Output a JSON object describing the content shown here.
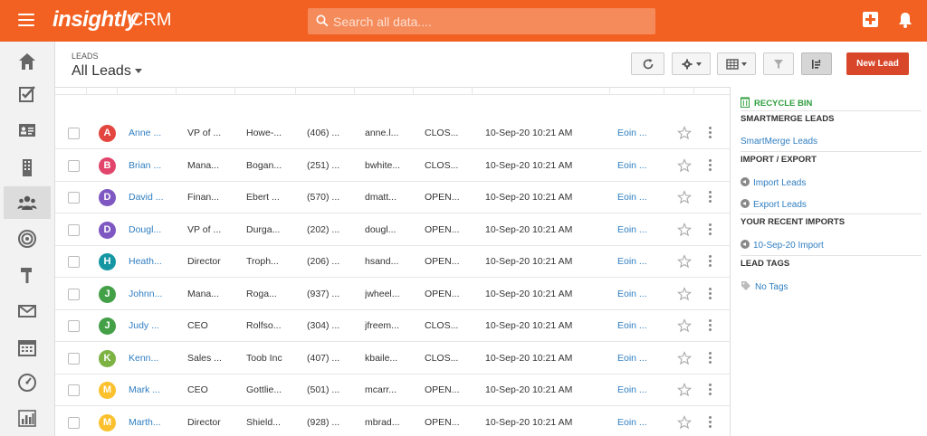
{
  "app": {
    "logo": "insightly",
    "name": "CRM",
    "brand_color": "#f26122"
  },
  "search": {
    "placeholder": "Search all data...."
  },
  "sidebar": {
    "items": [
      {
        "icon": "home-icon"
      },
      {
        "icon": "tasks-icon"
      },
      {
        "icon": "contacts-icon"
      },
      {
        "icon": "organizations-icon"
      },
      {
        "icon": "leads-icon",
        "active": true
      },
      {
        "icon": "opportunities-icon"
      },
      {
        "icon": "projects-icon"
      },
      {
        "icon": "email-icon"
      },
      {
        "icon": "calendar-icon"
      },
      {
        "icon": "dashboard-icon"
      },
      {
        "icon": "reports-icon"
      }
    ]
  },
  "header": {
    "breadcrumb": "LEADS",
    "view_title": "All Leads",
    "new_lead_label": "New Lead"
  },
  "leads": [
    {
      "initial": "A",
      "color": "#e2463e",
      "name": "Anne ...",
      "title": "VP of ...",
      "org": "Howe-...",
      "phone": "(406) ...",
      "email": "anne.l...",
      "status": "CLOS...",
      "date": "10-Sep-20 10:21 AM",
      "owner": "Eoin ..."
    },
    {
      "initial": "B",
      "color": "#e2456b",
      "name": "Brian ...",
      "title": "Mana...",
      "org": "Bogan...",
      "phone": "(251) ...",
      "email": "bwhite...",
      "status": "CLOS...",
      "date": "10-Sep-20 10:21 AM",
      "owner": "Eoin ..."
    },
    {
      "initial": "D",
      "color": "#7e57c2",
      "name": "David ...",
      "title": "Finan...",
      "org": "Ebert ...",
      "phone": "(570) ...",
      "email": "dmatt...",
      "status": "OPEN...",
      "date": "10-Sep-20 10:21 AM",
      "owner": "Eoin ..."
    },
    {
      "initial": "D",
      "color": "#7e57c2",
      "name": "Dougl...",
      "title": "VP of ...",
      "org": "Durga...",
      "phone": "(202) ...",
      "email": "dougl...",
      "status": "OPEN...",
      "date": "10-Sep-20 10:21 AM",
      "owner": "Eoin ..."
    },
    {
      "initial": "H",
      "color": "#1596a3",
      "name": "Heath...",
      "title": "Director",
      "org": "Troph...",
      "phone": "(206) ...",
      "email": "hsand...",
      "status": "OPEN...",
      "date": "10-Sep-20 10:21 AM",
      "owner": "Eoin ..."
    },
    {
      "initial": "J",
      "color": "#43a047",
      "name": "Johnn...",
      "title": "Mana...",
      "org": "Roga...",
      "phone": "(937) ...",
      "email": "jwheel...",
      "status": "OPEN...",
      "date": "10-Sep-20 10:21 AM",
      "owner": "Eoin ..."
    },
    {
      "initial": "J",
      "color": "#43a047",
      "name": "Judy ...",
      "title": "CEO",
      "org": "Rolfso...",
      "phone": "(304) ...",
      "email": "jfreem...",
      "status": "CLOS...",
      "date": "10-Sep-20 10:21 AM",
      "owner": "Eoin ..."
    },
    {
      "initial": "K",
      "color": "#7cb342",
      "name": "Kenn...",
      "title": "Sales ...",
      "org": "Toob Inc",
      "phone": "(407) ...",
      "email": "kbaile...",
      "status": "CLOS...",
      "date": "10-Sep-20 10:21 AM",
      "owner": "Eoin ..."
    },
    {
      "initial": "M",
      "color": "#fbc02d",
      "name": "Mark ...",
      "title": "CEO",
      "org": "Gottlie...",
      "phone": "(501) ...",
      "email": "mcarr...",
      "status": "OPEN...",
      "date": "10-Sep-20 10:21 AM",
      "owner": "Eoin ..."
    },
    {
      "initial": "M",
      "color": "#fbc02d",
      "name": "Marth...",
      "title": "Director",
      "org": "Shield...",
      "phone": "(928) ...",
      "email": "mbrad...",
      "status": "OPEN...",
      "date": "10-Sep-20 10:21 AM",
      "owner": "Eoin ..."
    }
  ],
  "right_panel": {
    "recycle_bin": "RECYCLE BIN",
    "smartmerge_heading": "SMARTMERGE LEADS",
    "smartmerge_link": "SmartMerge Leads",
    "import_export_heading": "IMPORT / EXPORT",
    "import_link": "Import Leads",
    "export_link": "Export Leads",
    "recent_imports_heading": "YOUR RECENT IMPORTS",
    "recent_import_link": "10-Sep-20 Import",
    "lead_tags_heading": "LEAD TAGS",
    "no_tags_link": "No Tags"
  }
}
